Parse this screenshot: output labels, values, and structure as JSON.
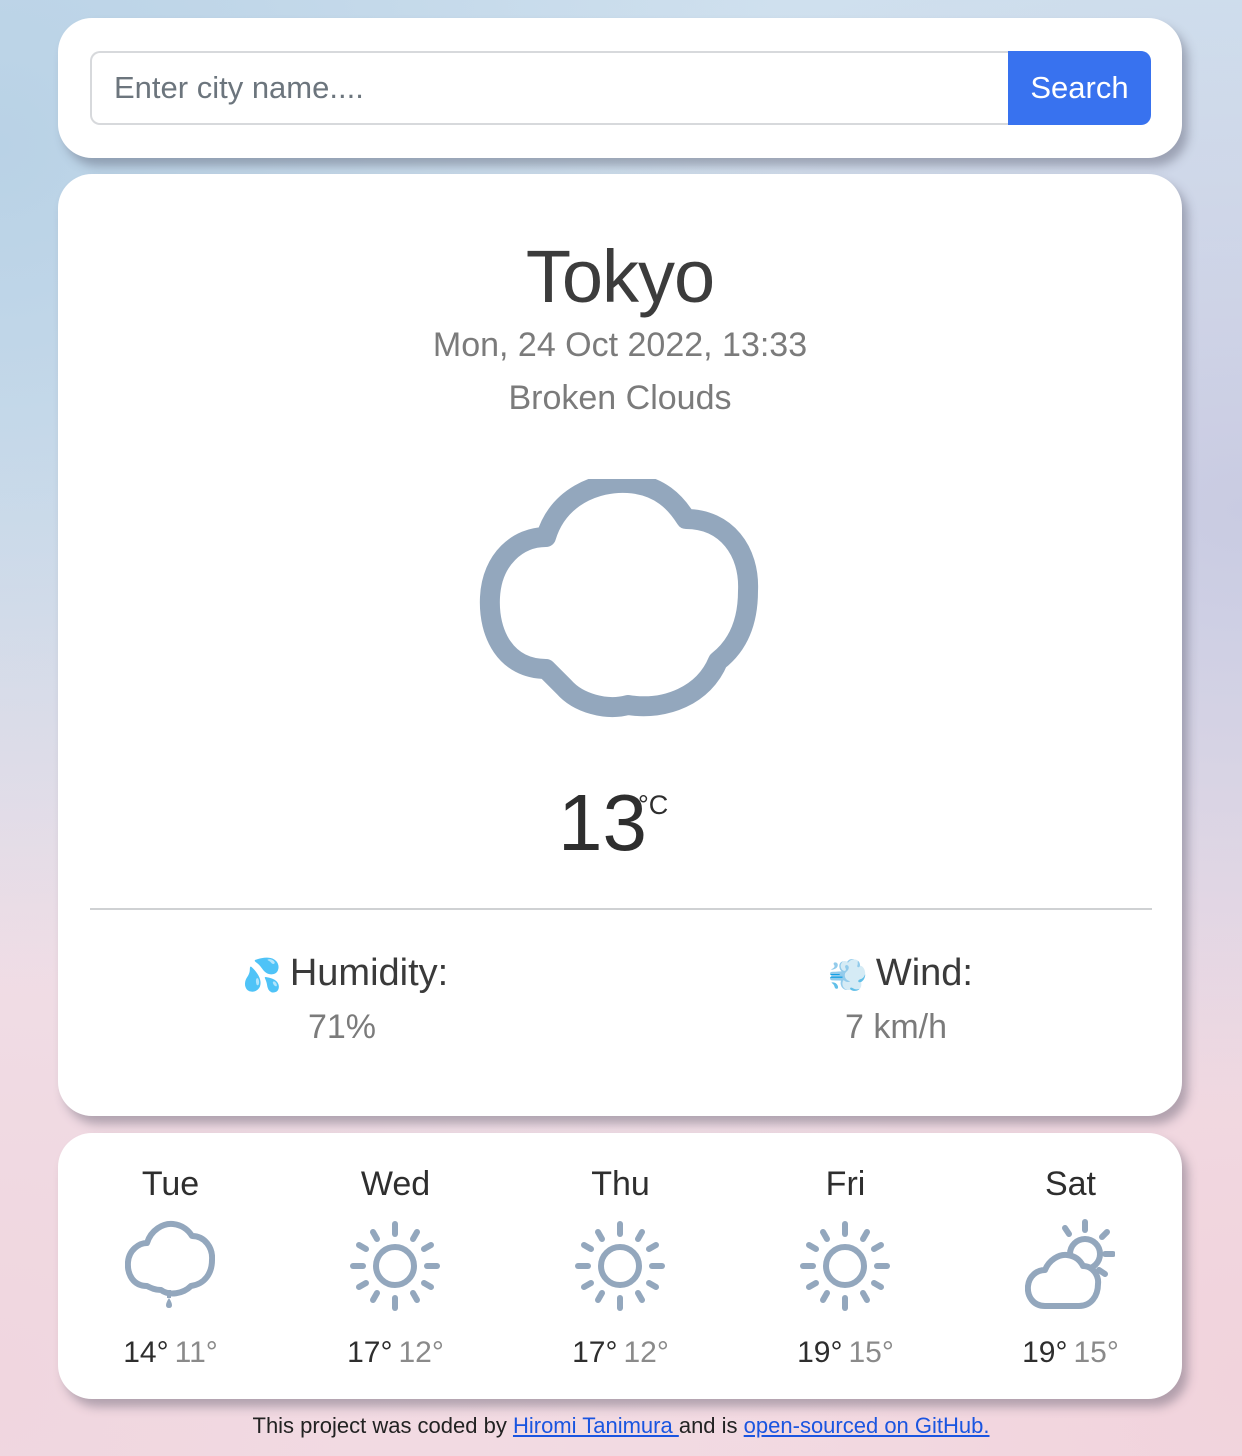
{
  "search": {
    "placeholder": "Enter city name....",
    "button_label": "Search",
    "button_color": "#3872ef"
  },
  "current": {
    "city": "Tokyo",
    "datetime": "Mon, 24 Oct 2022, 13:33",
    "description": "Broken Clouds",
    "icon": "cloud-icon",
    "temperature": "13",
    "unit": "°C"
  },
  "stats": {
    "humidity": {
      "icon": "💦",
      "label": "Humidity:",
      "value": "71%"
    },
    "wind": {
      "icon": "💨",
      "label": "Wind:",
      "value": "7 km/h"
    }
  },
  "forecast": [
    {
      "day": "Tue",
      "icon": "rain-icon",
      "high": "14°",
      "low": "11°"
    },
    {
      "day": "Wed",
      "icon": "sun-icon",
      "high": "17°",
      "low": "12°"
    },
    {
      "day": "Thu",
      "icon": "sun-icon",
      "high": "17°",
      "low": "12°"
    },
    {
      "day": "Fri",
      "icon": "sun-icon",
      "high": "19°",
      "low": "15°"
    },
    {
      "day": "Sat",
      "icon": "partly-cloudy-icon",
      "high": "19°",
      "low": "15°"
    }
  ],
  "footer": {
    "prefix": "This project was coded by",
    "author_link": "Hiromi Tanimura ",
    "middle": "and is",
    "repo_link": "open-sourced on GitHub."
  }
}
